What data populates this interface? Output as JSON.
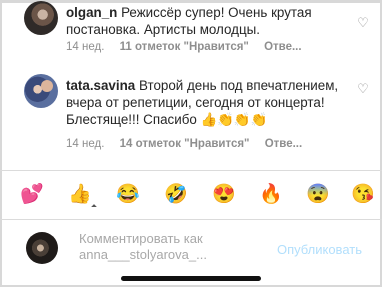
{
  "comments": [
    {
      "username": "olgan_n",
      "text": "Режиссёр супер! Очень крутая постановка. Артисты молодцы.",
      "time": "14 нед.",
      "likes": "11 отметок \"Нравится\"",
      "reply": "Отве..."
    },
    {
      "username": "tata.savina",
      "text": "Второй день под впечатлением, вчера от репетиции, сегодня от концерта! Блестяще!!! Спасибо 👍👏👏👏",
      "time": "14 нед.",
      "likes": "14 отметок \"Нравится\"",
      "reply": "Отве..."
    }
  ],
  "like_icon": "heart-outline-icon",
  "emoji_bar": [
    "💕",
    "👍",
    "😂",
    "🤣",
    "😍",
    "🔥",
    "😨",
    "😘"
  ],
  "composer": {
    "placeholder": "Комментировать как anna___stolyarova_...",
    "publish_label": "Опубликовать"
  },
  "colors": {
    "text": "#262626",
    "secondary": "#8e8e8e",
    "publish_disabled": "#b2dffc"
  }
}
